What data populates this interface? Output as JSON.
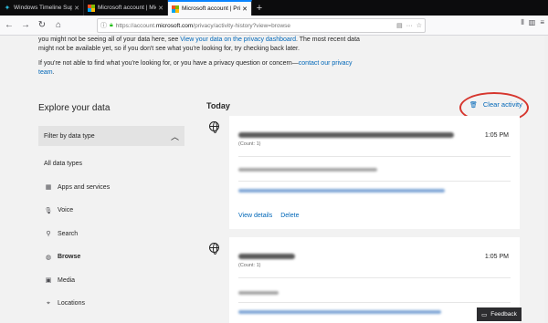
{
  "tabs": [
    {
      "title": "Windows Timeline Support - A",
      "favicon": "timeline-icon",
      "active": false
    },
    {
      "title": "Microsoft account | Microsoft A",
      "favicon": "microsoft-icon",
      "active": false
    },
    {
      "title": "Microsoft account | Privacy",
      "favicon": "microsoft-icon",
      "active": true
    }
  ],
  "new_tab_label": "+",
  "url": {
    "prefix": "https://account.",
    "domain": "microsoft.com",
    "path": "/privacy/activity-history?view=browse"
  },
  "intro": {
    "line1_a": "you might not be seeing all of your data here, see ",
    "line1_link": "View your data on the privacy dashboard",
    "line1_b": ". The most recent data might not be available yet, so if you don't see what you're looking for, try checking back later.",
    "line2_a": "If you're not able to find what you're looking for, or you have a privacy question or concern—",
    "line2_link": "contact our privacy team",
    "line2_b": "."
  },
  "sidebar": {
    "title": "Explore your data",
    "filter_label": "Filter by data type",
    "items": [
      {
        "label": "All data types",
        "icon": "",
        "bold": false
      },
      {
        "label": "Apps and services",
        "icon": "apps-icon",
        "bold": false
      },
      {
        "label": "Voice",
        "icon": "microphone-icon",
        "bold": false
      },
      {
        "label": "Search",
        "icon": "search-icon",
        "bold": false
      },
      {
        "label": "Browse",
        "icon": "globe-icon",
        "bold": true
      },
      {
        "label": "Media",
        "icon": "media-icon",
        "bold": false
      },
      {
        "label": "Locations",
        "icon": "location-icon",
        "bold": false
      }
    ]
  },
  "main": {
    "section_title": "Today",
    "clear_label": "Clear activity",
    "cards": [
      {
        "time": "1:05 PM",
        "count": "(Count: 1)",
        "actions": [
          "View details",
          "Delete"
        ]
      },
      {
        "time": "1:05 PM",
        "count": "(Count: 1)"
      }
    ]
  },
  "feedback_label": "Feedback",
  "colors": {
    "link": "#0067b8",
    "annotation": "#d6362e",
    "tab_active_accent": "#0a84ff"
  }
}
